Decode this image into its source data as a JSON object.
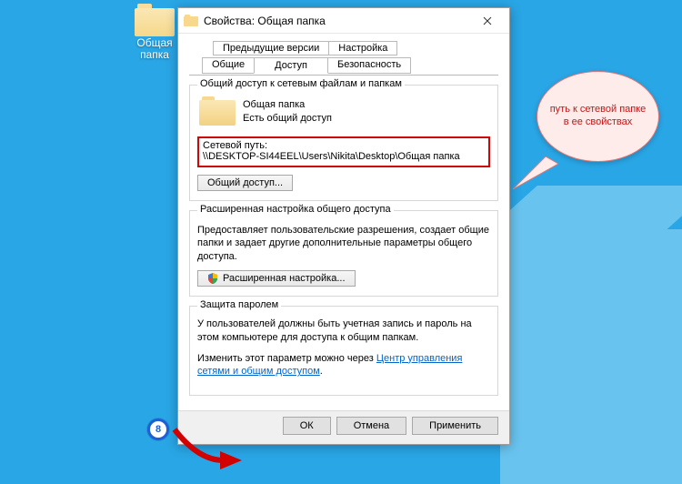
{
  "desktop_icon_label": "Общая папка",
  "dialog_title": "Свойства: Общая папка",
  "tabs_top": [
    "Предыдущие версии",
    "Настройка"
  ],
  "tabs_bot": [
    "Общие",
    "Доступ",
    "Безопасность"
  ],
  "group_share_legend": "Общий доступ к сетевым файлам и папкам",
  "share_name": "Общая папка",
  "share_status": "Есть общий доступ",
  "netpath_label": "Сетевой путь:",
  "netpath_value": "\\\\DESKTOP-SI44EEL\\Users\\Nikita\\Desktop\\Общая папка",
  "btn_share": "Общий доступ...",
  "group_adv_legend": "Расширенная настройка общего доступа",
  "adv_text": "Предоставляет пользовательские разрешения, создает общие папки и задает другие дополнительные параметры общего доступа.",
  "btn_adv": "Расширенная настройка...",
  "group_protect_legend": "Защита паролем",
  "protect_text": "У пользователей должны быть учетная запись и пароль на этом компьютере для доступа к общим папкам.",
  "protect_change_prefix": "Изменить этот параметр можно через ",
  "protect_link": "Центр управления сетями и общим доступом",
  "btn_ok": "ОК",
  "btn_cancel": "Отмена",
  "btn_apply": "Применить",
  "callout_text": "путь к сетевой папке в ее свойствах",
  "step_number": "8"
}
